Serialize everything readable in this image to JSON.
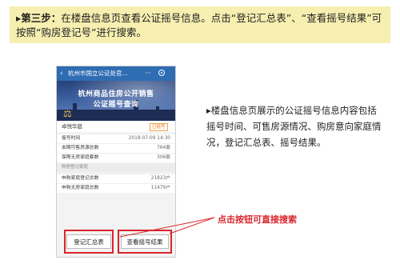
{
  "banner": {
    "step": "▸第三步：",
    "text": "在楼盘信息页查看公证摇号信息。点击“登记汇总表”、“查看摇号结果”可按照“购房登记号”进行搜索。"
  },
  "phone": {
    "title": "杭州市国立公证处官...",
    "back_icon": "‹",
    "more_icon": "···",
    "hero_line1": "杭州商品住房公开销售",
    "hero_line2": "公证摇号查询",
    "project_name": "卓悦华庭",
    "project_badge": "已摇号",
    "rows": [
      {
        "label": "摇号时间",
        "value": "2018-07-09 14:30"
      },
      {
        "label": "本期可售房源总数",
        "value": "764套"
      },
      {
        "label": "保障无房家庭套数",
        "value": "306套"
      }
    ],
    "section_label": "购房登记家庭",
    "rows2": [
      {
        "label": "申购家庭登记总数",
        "value": "21823户"
      },
      {
        "label": "申购无房家庭总数",
        "value": "11479户"
      }
    ],
    "btn_summary": "登记汇总表",
    "btn_result": "查看摇号结果"
  },
  "description": "▸楼盘信息页展示的公证摇号信息内容包括摇号时间、可售房源情况、购房意向家庭情况，登记汇总表、摇号结果。",
  "callout": "点击按钮可直接搜索",
  "colors": {
    "accent_red": "#d9242a",
    "banner_bg": "#f6efb0",
    "titlebar": "#2f6db3"
  }
}
